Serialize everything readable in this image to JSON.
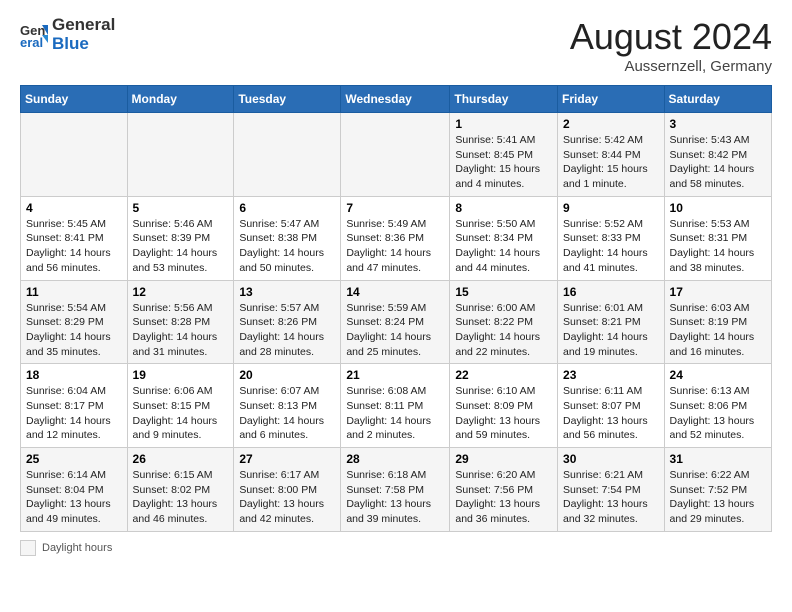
{
  "header": {
    "logo_general": "General",
    "logo_blue": "Blue",
    "title": "August 2024",
    "location": "Aussernzell, Germany"
  },
  "footer": {
    "daylight_label": "Daylight hours"
  },
  "days_of_week": [
    "Sunday",
    "Monday",
    "Tuesday",
    "Wednesday",
    "Thursday",
    "Friday",
    "Saturday"
  ],
  "weeks": [
    [
      {
        "day": "",
        "info": ""
      },
      {
        "day": "",
        "info": ""
      },
      {
        "day": "",
        "info": ""
      },
      {
        "day": "",
        "info": ""
      },
      {
        "day": "1",
        "info": "Sunrise: 5:41 AM\nSunset: 8:45 PM\nDaylight: 15 hours\nand 4 minutes."
      },
      {
        "day": "2",
        "info": "Sunrise: 5:42 AM\nSunset: 8:44 PM\nDaylight: 15 hours\nand 1 minute."
      },
      {
        "day": "3",
        "info": "Sunrise: 5:43 AM\nSunset: 8:42 PM\nDaylight: 14 hours\nand 58 minutes."
      }
    ],
    [
      {
        "day": "4",
        "info": "Sunrise: 5:45 AM\nSunset: 8:41 PM\nDaylight: 14 hours\nand 56 minutes."
      },
      {
        "day": "5",
        "info": "Sunrise: 5:46 AM\nSunset: 8:39 PM\nDaylight: 14 hours\nand 53 minutes."
      },
      {
        "day": "6",
        "info": "Sunrise: 5:47 AM\nSunset: 8:38 PM\nDaylight: 14 hours\nand 50 minutes."
      },
      {
        "day": "7",
        "info": "Sunrise: 5:49 AM\nSunset: 8:36 PM\nDaylight: 14 hours\nand 47 minutes."
      },
      {
        "day": "8",
        "info": "Sunrise: 5:50 AM\nSunset: 8:34 PM\nDaylight: 14 hours\nand 44 minutes."
      },
      {
        "day": "9",
        "info": "Sunrise: 5:52 AM\nSunset: 8:33 PM\nDaylight: 14 hours\nand 41 minutes."
      },
      {
        "day": "10",
        "info": "Sunrise: 5:53 AM\nSunset: 8:31 PM\nDaylight: 14 hours\nand 38 minutes."
      }
    ],
    [
      {
        "day": "11",
        "info": "Sunrise: 5:54 AM\nSunset: 8:29 PM\nDaylight: 14 hours\nand 35 minutes."
      },
      {
        "day": "12",
        "info": "Sunrise: 5:56 AM\nSunset: 8:28 PM\nDaylight: 14 hours\nand 31 minutes."
      },
      {
        "day": "13",
        "info": "Sunrise: 5:57 AM\nSunset: 8:26 PM\nDaylight: 14 hours\nand 28 minutes."
      },
      {
        "day": "14",
        "info": "Sunrise: 5:59 AM\nSunset: 8:24 PM\nDaylight: 14 hours\nand 25 minutes."
      },
      {
        "day": "15",
        "info": "Sunrise: 6:00 AM\nSunset: 8:22 PM\nDaylight: 14 hours\nand 22 minutes."
      },
      {
        "day": "16",
        "info": "Sunrise: 6:01 AM\nSunset: 8:21 PM\nDaylight: 14 hours\nand 19 minutes."
      },
      {
        "day": "17",
        "info": "Sunrise: 6:03 AM\nSunset: 8:19 PM\nDaylight: 14 hours\nand 16 minutes."
      }
    ],
    [
      {
        "day": "18",
        "info": "Sunrise: 6:04 AM\nSunset: 8:17 PM\nDaylight: 14 hours\nand 12 minutes."
      },
      {
        "day": "19",
        "info": "Sunrise: 6:06 AM\nSunset: 8:15 PM\nDaylight: 14 hours\nand 9 minutes."
      },
      {
        "day": "20",
        "info": "Sunrise: 6:07 AM\nSunset: 8:13 PM\nDaylight: 14 hours\nand 6 minutes."
      },
      {
        "day": "21",
        "info": "Sunrise: 6:08 AM\nSunset: 8:11 PM\nDaylight: 14 hours\nand 2 minutes."
      },
      {
        "day": "22",
        "info": "Sunrise: 6:10 AM\nSunset: 8:09 PM\nDaylight: 13 hours\nand 59 minutes."
      },
      {
        "day": "23",
        "info": "Sunrise: 6:11 AM\nSunset: 8:07 PM\nDaylight: 13 hours\nand 56 minutes."
      },
      {
        "day": "24",
        "info": "Sunrise: 6:13 AM\nSunset: 8:06 PM\nDaylight: 13 hours\nand 52 minutes."
      }
    ],
    [
      {
        "day": "25",
        "info": "Sunrise: 6:14 AM\nSunset: 8:04 PM\nDaylight: 13 hours\nand 49 minutes."
      },
      {
        "day": "26",
        "info": "Sunrise: 6:15 AM\nSunset: 8:02 PM\nDaylight: 13 hours\nand 46 minutes."
      },
      {
        "day": "27",
        "info": "Sunrise: 6:17 AM\nSunset: 8:00 PM\nDaylight: 13 hours\nand 42 minutes."
      },
      {
        "day": "28",
        "info": "Sunrise: 6:18 AM\nSunset: 7:58 PM\nDaylight: 13 hours\nand 39 minutes."
      },
      {
        "day": "29",
        "info": "Sunrise: 6:20 AM\nSunset: 7:56 PM\nDaylight: 13 hours\nand 36 minutes."
      },
      {
        "day": "30",
        "info": "Sunrise: 6:21 AM\nSunset: 7:54 PM\nDaylight: 13 hours\nand 32 minutes."
      },
      {
        "day": "31",
        "info": "Sunrise: 6:22 AM\nSunset: 7:52 PM\nDaylight: 13 hours\nand 29 minutes."
      }
    ]
  ]
}
